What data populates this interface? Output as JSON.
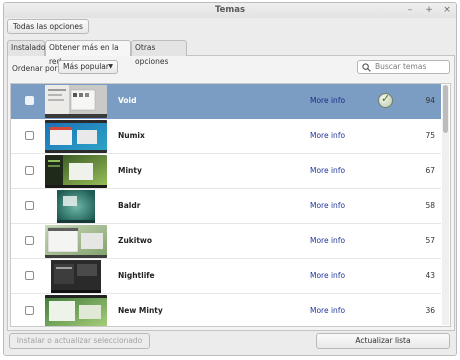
{
  "window": {
    "title": "Temas",
    "controls": [
      "–",
      "+",
      "×"
    ]
  },
  "toolbar": {
    "all_options_label": "Todas las opciones"
  },
  "tabs": [
    {
      "label": "Instalado",
      "active": false
    },
    {
      "label": "Obtener más en la red",
      "active": true
    },
    {
      "label": "Otras opciones",
      "active": false
    }
  ],
  "sort": {
    "label": "Ordenar por",
    "selected": "Más popular"
  },
  "search": {
    "placeholder": "Buscar temas"
  },
  "themes": [
    {
      "name": "Void",
      "more": "More info",
      "count": "94",
      "selected": true,
      "installed": true
    },
    {
      "name": "Numix",
      "more": "More info",
      "count": "75",
      "selected": false,
      "installed": false
    },
    {
      "name": "Minty",
      "more": "More info",
      "count": "67",
      "selected": false,
      "installed": false
    },
    {
      "name": "Baldr",
      "more": "More info",
      "count": "58",
      "selected": false,
      "installed": false
    },
    {
      "name": "Zukitwo",
      "more": "More info",
      "count": "57",
      "selected": false,
      "installed": false
    },
    {
      "name": "Nightlife",
      "more": "More info",
      "count": "43",
      "selected": false,
      "installed": false
    },
    {
      "name": "New Minty",
      "more": "More info",
      "count": "36",
      "selected": false,
      "installed": false
    }
  ],
  "footer": {
    "install_label": "Instalar o actualizar seleccionado",
    "refresh_label": "Actualizar lista"
  },
  "colors": {
    "selection": "#7b9dc4",
    "link": "#20369a"
  }
}
